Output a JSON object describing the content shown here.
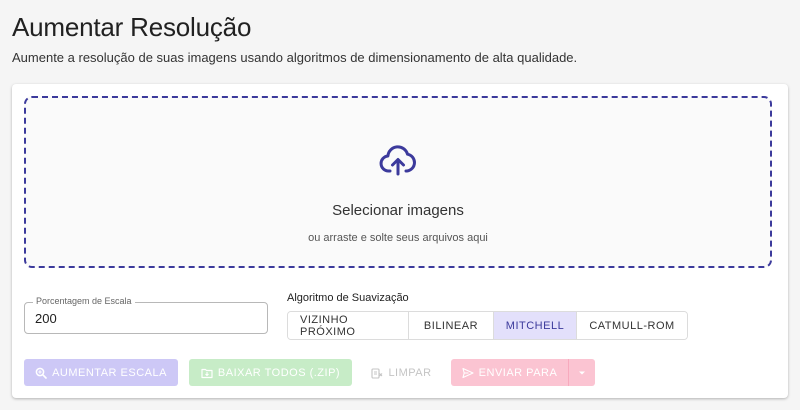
{
  "page": {
    "title": "Aumentar Resolução",
    "subtitle": "Aumente a resolução de suas imagens usando algoritmos de dimensionamento de alta qualidade."
  },
  "dropzone": {
    "icon": "cloud-upload-icon",
    "title": "Selecionar imagens",
    "hint": "ou arraste e solte seus arquivos aqui"
  },
  "scale": {
    "label": "Porcentagem de Escala",
    "value": "200"
  },
  "algorithm": {
    "label": "Algoritmo de Suavização",
    "options": [
      "VIZINHO PRÓXIMO",
      "BILINEAR",
      "MITCHELL",
      "CATMULL-ROM"
    ],
    "selected": "MITCHELL"
  },
  "actions": {
    "upscale_label": "AUMENTAR ESCALA",
    "download_label": "BAIXAR TODOS (.ZIP)",
    "clear_label": "LIMPAR",
    "send_label": "ENVIAR PARA"
  },
  "colors": {
    "accent": "#3c3a9c",
    "selected_bg": "#e3e0fb",
    "upscale_disabled": "#cdc8f6",
    "download_disabled": "#c7ecc7",
    "send_disabled": "#fbc4d2"
  }
}
